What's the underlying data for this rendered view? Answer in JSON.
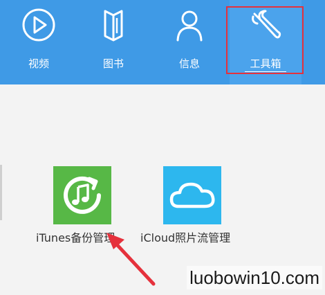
{
  "toolbar": {
    "items": [
      {
        "label": "视频",
        "icon": "video-play-icon"
      },
      {
        "label": "图书",
        "icon": "book-icon"
      },
      {
        "label": "信息",
        "icon": "person-icon"
      },
      {
        "label": "工具箱",
        "icon": "wrench-icon",
        "active": true
      }
    ],
    "background": "#3f9ae6",
    "annotation_color": "#e5313c"
  },
  "apps": [
    {
      "label": "iTunes备份管理",
      "icon": "itunes-backup-icon",
      "color": "#57b846"
    },
    {
      "label": "iCloud照片流管理",
      "icon": "icloud-photo-stream-icon",
      "color": "#2db7ee"
    }
  ],
  "watermark": "luobowin10.com"
}
